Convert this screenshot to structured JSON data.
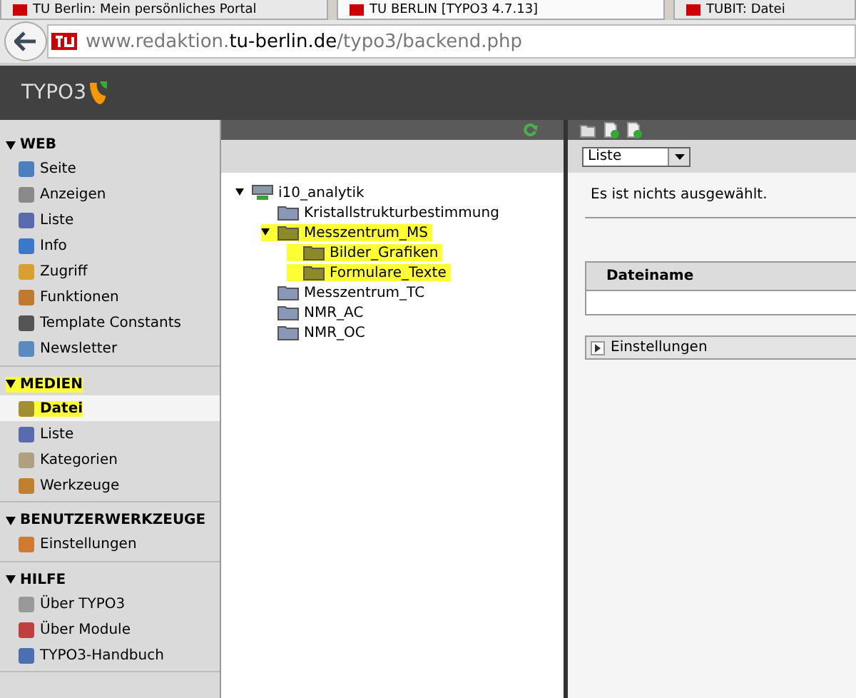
{
  "browser": {
    "tabs": [
      {
        "label": "TU Berlin: Mein persönliches Portal",
        "selected": false
      },
      {
        "label": "TU BERLIN [TYPO3 4.7.13]",
        "selected": true
      },
      {
        "label": "TUBIT: Datei",
        "selected": false
      }
    ],
    "url": {
      "host_prefix": "www.redaktion.",
      "domain": "tu-berlin.de",
      "path": "/typo3/backend.php"
    }
  },
  "header": {
    "logo": "TYPO3"
  },
  "sidebar": {
    "groups": [
      {
        "title": "WEB",
        "expanded": true,
        "highlighted": false,
        "items": [
          {
            "label": "Seite",
            "selected": false,
            "highlighted": false
          },
          {
            "label": "Anzeigen",
            "selected": false,
            "highlighted": false
          },
          {
            "label": "Liste",
            "selected": false,
            "highlighted": false
          },
          {
            "label": "Info",
            "selected": false,
            "highlighted": false
          },
          {
            "label": "Zugriff",
            "selected": false,
            "highlighted": false
          },
          {
            "label": "Funktionen",
            "selected": false,
            "highlighted": false
          },
          {
            "label": "Template Constants",
            "selected": false,
            "highlighted": false
          },
          {
            "label": "Newsletter",
            "selected": false,
            "highlighted": false
          }
        ]
      },
      {
        "title": "MEDIEN",
        "expanded": true,
        "highlighted": true,
        "items": [
          {
            "label": "Datei",
            "selected": true,
            "highlighted": true
          },
          {
            "label": "Liste",
            "selected": false,
            "highlighted": false
          },
          {
            "label": "Kategorien",
            "selected": false,
            "highlighted": false
          },
          {
            "label": "Werkzeuge",
            "selected": false,
            "highlighted": false
          }
        ]
      },
      {
        "title": "BENUTZERWERKZEUGE",
        "expanded": true,
        "highlighted": false,
        "items": [
          {
            "label": "Einstellungen",
            "selected": false,
            "highlighted": false
          }
        ]
      },
      {
        "title": "HILFE",
        "expanded": true,
        "highlighted": false,
        "items": [
          {
            "label": "Über TYPO3",
            "selected": false,
            "highlighted": false
          },
          {
            "label": "Über Module",
            "selected": false,
            "highlighted": false
          },
          {
            "label": "TYPO3-Handbuch",
            "selected": false,
            "highlighted": false
          }
        ]
      }
    ]
  },
  "tree": {
    "root": {
      "label": "i10_analytik",
      "kind": "storage",
      "expanded": true,
      "highlighted": false,
      "children": [
        {
          "label": "Kristallstrukturbestimmung",
          "kind": "folder",
          "expanded": false,
          "highlighted": false
        },
        {
          "label": "Messzentrum_MS",
          "kind": "folder",
          "expanded": true,
          "highlighted": true,
          "children": [
            {
              "label": "Bilder_Grafiken",
              "kind": "folder",
              "expanded": false,
              "highlighted": true
            },
            {
              "label": "Formulare_Texte",
              "kind": "folder",
              "expanded": false,
              "highlighted": true
            }
          ]
        },
        {
          "label": "Messzentrum_TC",
          "kind": "folder",
          "expanded": false,
          "highlighted": false
        },
        {
          "label": "NMR_AC",
          "kind": "folder",
          "expanded": false,
          "highlighted": false
        },
        {
          "label": "NMR_OC",
          "kind": "folder",
          "expanded": false,
          "highlighted": false
        }
      ]
    }
  },
  "content": {
    "view_select": {
      "value": "Liste"
    },
    "message": "Es ist nichts ausgewählt.",
    "table": {
      "columns": [
        "Dateiname"
      ]
    },
    "settings_panel": {
      "title": "Einstellungen",
      "expanded": false
    }
  }
}
